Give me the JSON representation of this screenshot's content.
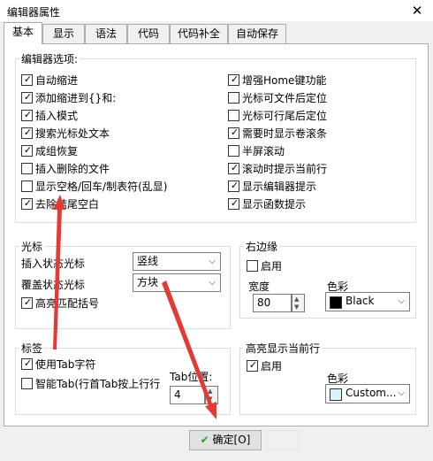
{
  "window": {
    "title": "编辑器属性"
  },
  "tabs": [
    "基本",
    "显示",
    "语法",
    "代码",
    "代码补全",
    "自动保存"
  ],
  "editor_options": {
    "label": "编辑器选项:",
    "left": [
      {
        "label": "自动缩进",
        "checked": true
      },
      {
        "label": "添加缩进到{}和:",
        "checked": true
      },
      {
        "label": "插入模式",
        "checked": true
      },
      {
        "label": "搜索光标处文本",
        "checked": true
      },
      {
        "label": "成组恢复",
        "checked": true
      },
      {
        "label": "插入删除的文件",
        "checked": false
      },
      {
        "label": "显示空格/回车/制表符(乱显)",
        "checked": false
      },
      {
        "label": "去除結尾空白",
        "checked": true
      }
    ],
    "right": [
      {
        "label": "增强Home键功能",
        "checked": true
      },
      {
        "label": "光标可文件后定位",
        "checked": false
      },
      {
        "label": "光标可行尾后定位",
        "checked": false
      },
      {
        "label": "需要时显示卷滚条",
        "checked": true
      },
      {
        "label": "半屏滚动",
        "checked": false
      },
      {
        "label": "滚动时提示当前行",
        "checked": true
      },
      {
        "label": "显示编辑器提示",
        "checked": true
      },
      {
        "label": "显示函数提示",
        "checked": true
      }
    ]
  },
  "cursor": {
    "label": "光标",
    "insert_label": "插入状态光标",
    "insert_value": "竖线",
    "overwrite_label": "覆盖状态光标",
    "overwrite_value": "方块",
    "highlight_brackets": {
      "label": "高亮匹配括号",
      "checked": true
    }
  },
  "right_margin": {
    "label": "右边缘",
    "enable": {
      "label": "启用",
      "checked": false
    },
    "width_label": "宽度",
    "width_value": "80",
    "color_label": "色彩",
    "color_value": "Black",
    "color_swatch": "#000000"
  },
  "tabs_group": {
    "label": "标签",
    "use_tab": {
      "label": "使用Tab字符",
      "checked": true
    },
    "smart_tab": {
      "label": "智能Tab(行首Tab按上行行",
      "checked": false
    },
    "tab_pos_label": "Tab位置:",
    "tab_pos_value": "4"
  },
  "highlight_line": {
    "label": "高亮显示当前行",
    "enable": {
      "label": "启用",
      "checked": true
    },
    "color_label": "色彩",
    "color_value": "Custom...",
    "color_swatch": "#d8f4ff"
  },
  "footer": {
    "ok_label": "确定[O]"
  },
  "icons": {
    "ok": "checkmark-icon",
    "close": "close-icon",
    "dropdown": "chevron-down-icon"
  },
  "colors": {
    "annotation_arrow": "#e53935",
    "ok_check": "#2e9a2e"
  }
}
